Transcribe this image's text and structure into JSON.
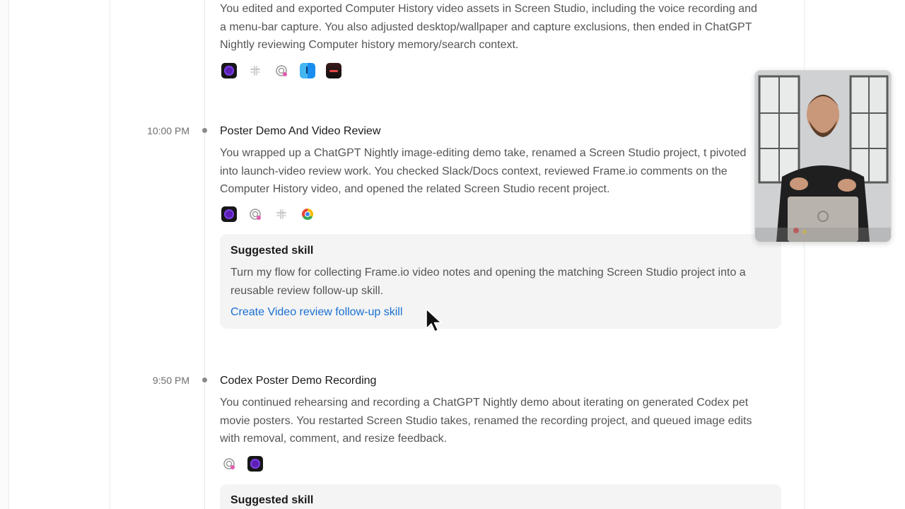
{
  "entries": [
    {
      "time": "",
      "title": "",
      "description": "You edited and exported Computer History video assets in Screen Studio, including the voice recording and a menu-bar capture. You also adjusted desktop/wallpaper and capture exclusions, then ended in ChatGPT Nightly reviewing Computer history memory/search context.",
      "apps": [
        "screen-studio-icon",
        "slack-icon",
        "chatgpt-nightly-icon",
        "finder-icon",
        "dark-app-icon"
      ]
    },
    {
      "time": "10:00 PM",
      "title": "Poster Demo And Video Review",
      "description": "You wrapped up a ChatGPT Nightly image-editing demo take, renamed a Screen Studio project, t pivoted into launch-video review work. You checked Slack/Docs context, reviewed Frame.io comments on the Computer History video, and opened the related Screen Studio recent project.",
      "apps": [
        "screen-studio-icon",
        "chatgpt-nightly-icon",
        "slack-icon",
        "chrome-icon"
      ],
      "suggested_skill": {
        "heading": "Suggested skill",
        "description": "Turn my flow for collecting Frame.io video notes and opening the matching Screen Studio project into a reusable review follow-up skill.",
        "link_label": "Create Video review follow-up skill"
      }
    },
    {
      "time": "9:50 PM",
      "title": "Codex Poster Demo Recording",
      "description": "You continued rehearsing and recording a ChatGPT Nightly demo about iterating on generated Codex pet movie posters. You restarted Screen Studio takes, renamed the recording project, and queued image edits with removal, comment, and resize feedback.",
      "apps": [
        "chatgpt-nightly-icon",
        "screen-studio-icon"
      ],
      "suggested_skill": {
        "heading": "Suggested skill"
      }
    }
  ],
  "colors": {
    "link": "#1a6fd1",
    "card_background": "#f4f4f4",
    "muted_text": "#555555",
    "time_text": "#6f6f6f"
  }
}
